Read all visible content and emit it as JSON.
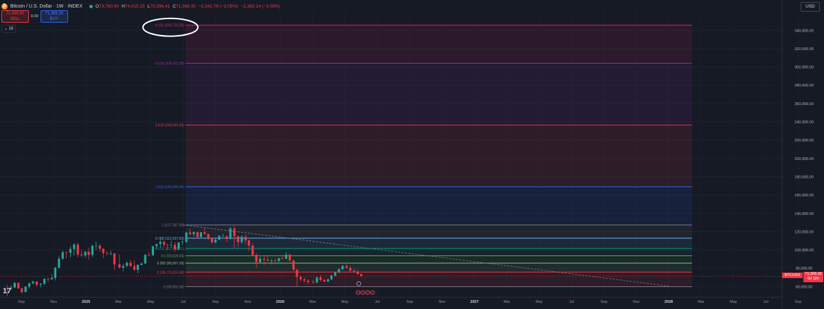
{
  "header": {
    "title": "Bitcoin / U.S. Dollar · 1W · INDEX",
    "ohlc": [
      {
        "k": "O",
        "v": "73,760.90"
      },
      {
        "k": "H",
        "v": "74,015.25"
      },
      {
        "k": "L",
        "v": "70,596.41"
      },
      {
        "k": "C",
        "v": "71,368.30"
      },
      {
        "k": "",
        "v": "−2,242.76 (−3.05%)"
      },
      {
        "k": "",
        "v": "−2,382.14 (−3.09%)"
      }
    ]
  },
  "trade": {
    "sell_price": "71,368.80",
    "sell_label": "SELL",
    "spread": "0.00",
    "buy_price": "71,368.30",
    "buy_label": "BUY"
  },
  "indicator_toggle": "⌄ 18",
  "currency": "USD",
  "last_price": {
    "symbol": "BTCUSD",
    "price": "71,368.30",
    "countdown": "6d 10h"
  },
  "colors": {
    "background": "#161a25",
    "up": "#26a69a",
    "down": "#f23645",
    "highlight_circle": "#ffffff"
  },
  "chart_data": {
    "type": "candlestick",
    "title": "",
    "ylim": [
      52000,
      362000
    ],
    "y_ticks": [
      60000,
      80000,
      100000,
      120000,
      140000,
      160000,
      180000,
      200000,
      220000,
      240000,
      260000,
      280000,
      300000,
      320000,
      340000
    ],
    "y_tick_labels": [
      "60,000.00",
      "80,000.00",
      "100,000.00",
      "120,000.00",
      "140,000.00",
      "160,000.00",
      "180,000.00",
      "200,000.00",
      "220,000.00",
      "240,000.00",
      "260,000.00",
      "280,000.00",
      "300,000.00",
      "320,000.00",
      "340,000.00"
    ],
    "x_labels": [
      "Sep",
      "Nov",
      "2025",
      "Mar",
      "May",
      "Jul",
      "Sep",
      "Nov",
      "2026",
      "Mar",
      "May",
      "Jul",
      "Sep",
      "Nov",
      "2027",
      "Mar",
      "May",
      "Jul",
      "Sep",
      "Nov",
      "2028",
      "Mar",
      "May",
      "Jul",
      "Sep"
    ],
    "x_bold": [
      "2025",
      "2026",
      "2027",
      "2028"
    ],
    "x_months_start": "2024-09",
    "fib_levels": [
      {
        "ratio": 0,
        "label": "0 (59,891.36)",
        "price": 59891.36,
        "color": "#787b86"
      },
      {
        "ratio": 0.236,
        "label": "0.236 (75,815.68)",
        "price": 75815.68,
        "color": "#f23645"
      },
      {
        "ratio": 0.382,
        "label": "0.382 (85,667.29)",
        "price": 85667.29,
        "color": "#81c784"
      },
      {
        "ratio": 0.5,
        "label": "0.5 (93,629.65)",
        "price": 93629.65,
        "color": "#4caf50"
      },
      {
        "ratio": 0.618,
        "label": "0.618 (101,592.01)",
        "price": 101592.01,
        "color": "#089981"
      },
      {
        "ratio": 0.786,
        "label": "0.786 (112,927.93)",
        "price": 112927.93,
        "color": "#64b5f6"
      },
      {
        "ratio": 1,
        "label": "1 (127,367.95)",
        "price": 127367.95,
        "color": "#787b86"
      },
      {
        "ratio": 1.618,
        "label": "1.618 (169,068.60)",
        "price": 169068.6,
        "color": "#2962ff"
      },
      {
        "ratio": 2.618,
        "label": "2.618 (236,545.29)",
        "price": 236545.29,
        "color": "#f23645"
      },
      {
        "ratio": 3.618,
        "label": "3.618 (304,022.18)",
        "price": 304022.18,
        "color": "#9c27b0"
      },
      {
        "ratio": 4.236,
        "label": "4.236 (345,720.56)",
        "price": 345720.56,
        "color": "#e91e63"
      }
    ],
    "trendline": {
      "from": {
        "x": "2025-07",
        "y": 127400
      },
      "to": {
        "x": "2028-01",
        "y": 60500
      }
    },
    "candles": [
      {
        "t": "2024-08-05",
        "o": 58000,
        "h": 62000,
        "l": 49500,
        "c": 57500
      },
      {
        "t": "2024-08-12",
        "o": 57500,
        "h": 61500,
        "l": 56000,
        "c": 59000
      },
      {
        "t": "2024-08-19",
        "o": 59000,
        "h": 65000,
        "l": 58500,
        "c": 64000
      },
      {
        "t": "2024-08-26",
        "o": 64000,
        "h": 64500,
        "l": 57500,
        "c": 58000
      },
      {
        "t": "2024-09-02",
        "o": 58000,
        "h": 58500,
        "l": 52500,
        "c": 54000
      },
      {
        "t": "2024-09-09",
        "o": 54000,
        "h": 60500,
        "l": 53500,
        "c": 60000
      },
      {
        "t": "2024-09-16",
        "o": 60000,
        "h": 64500,
        "l": 58000,
        "c": 63500
      },
      {
        "t": "2024-09-23",
        "o": 63500,
        "h": 66500,
        "l": 62500,
        "c": 65500
      },
      {
        "t": "2024-09-30",
        "o": 65500,
        "h": 66000,
        "l": 59800,
        "c": 62000
      },
      {
        "t": "2024-10-07",
        "o": 62000,
        "h": 64000,
        "l": 58900,
        "c": 63000
      },
      {
        "t": "2024-10-14",
        "o": 63000,
        "h": 69000,
        "l": 62000,
        "c": 68500
      },
      {
        "t": "2024-10-21",
        "o": 68500,
        "h": 69500,
        "l": 65000,
        "c": 68000
      },
      {
        "t": "2024-10-28",
        "o": 68000,
        "h": 73600,
        "l": 67500,
        "c": 69500
      },
      {
        "t": "2024-11-04",
        "o": 69500,
        "h": 81500,
        "l": 66800,
        "c": 80500
      },
      {
        "t": "2024-11-11",
        "o": 80500,
        "h": 93500,
        "l": 80000,
        "c": 90500
      },
      {
        "t": "2024-11-18",
        "o": 90500,
        "h": 99500,
        "l": 89000,
        "c": 97500
      },
      {
        "t": "2024-11-25",
        "o": 97500,
        "h": 98500,
        "l": 90800,
        "c": 97000
      },
      {
        "t": "2024-12-02",
        "o": 97000,
        "h": 104000,
        "l": 92000,
        "c": 101000
      },
      {
        "t": "2024-12-09",
        "o": 101000,
        "h": 107800,
        "l": 94000,
        "c": 106000
      },
      {
        "t": "2024-12-16",
        "o": 106000,
        "h": 108300,
        "l": 92200,
        "c": 95000
      },
      {
        "t": "2024-12-23",
        "o": 95000,
        "h": 100000,
        "l": 92500,
        "c": 94000
      },
      {
        "t": "2024-12-30",
        "o": 94000,
        "h": 99000,
        "l": 91500,
        "c": 98000
      },
      {
        "t": "2025-01-06",
        "o": 98000,
        "h": 102700,
        "l": 89300,
        "c": 94500
      },
      {
        "t": "2025-01-13",
        "o": 94500,
        "h": 106000,
        "l": 92000,
        "c": 104500
      },
      {
        "t": "2025-01-20",
        "o": 104500,
        "h": 109300,
        "l": 99500,
        "c": 104800
      },
      {
        "t": "2025-01-27",
        "o": 104800,
        "h": 106400,
        "l": 97800,
        "c": 101300
      },
      {
        "t": "2025-02-03",
        "o": 101300,
        "h": 102000,
        "l": 91200,
        "c": 96500
      },
      {
        "t": "2025-02-10",
        "o": 96500,
        "h": 98800,
        "l": 94100,
        "c": 96100
      },
      {
        "t": "2025-02-17",
        "o": 96100,
        "h": 99500,
        "l": 94500,
        "c": 96300
      },
      {
        "t": "2025-02-24",
        "o": 96300,
        "h": 96500,
        "l": 78200,
        "c": 84300
      },
      {
        "t": "2025-03-03",
        "o": 84300,
        "h": 95000,
        "l": 80000,
        "c": 80700
      },
      {
        "t": "2025-03-10",
        "o": 80700,
        "h": 85300,
        "l": 76600,
        "c": 82600
      },
      {
        "t": "2025-03-17",
        "o": 82600,
        "h": 87500,
        "l": 81500,
        "c": 86100
      },
      {
        "t": "2025-03-24",
        "o": 86100,
        "h": 88800,
        "l": 81600,
        "c": 82400
      },
      {
        "t": "2025-03-31",
        "o": 82400,
        "h": 88500,
        "l": 77100,
        "c": 78400
      },
      {
        "t": "2025-04-07",
        "o": 78400,
        "h": 84000,
        "l": 74500,
        "c": 83800
      },
      {
        "t": "2025-04-14",
        "o": 83800,
        "h": 86500,
        "l": 83000,
        "c": 85200
      },
      {
        "t": "2025-04-21",
        "o": 85200,
        "h": 95800,
        "l": 85000,
        "c": 94600
      },
      {
        "t": "2025-04-28",
        "o": 94600,
        "h": 97800,
        "l": 92900,
        "c": 94300
      },
      {
        "t": "2025-05-05",
        "o": 94300,
        "h": 104300,
        "l": 93400,
        "c": 104100
      },
      {
        "t": "2025-05-12",
        "o": 104100,
        "h": 105800,
        "l": 100700,
        "c": 106500
      },
      {
        "t": "2025-05-19",
        "o": 106500,
        "h": 111900,
        "l": 102100,
        "c": 109000
      },
      {
        "t": "2025-05-26",
        "o": 109000,
        "h": 110400,
        "l": 103100,
        "c": 105700
      },
      {
        "t": "2025-06-02",
        "o": 105700,
        "h": 106800,
        "l": 100400,
        "c": 105500
      },
      {
        "t": "2025-06-09",
        "o": 105500,
        "h": 110500,
        "l": 102600,
        "c": 105600
      },
      {
        "t": "2025-06-16",
        "o": 105600,
        "h": 108900,
        "l": 98200,
        "c": 100900
      },
      {
        "t": "2025-06-23",
        "o": 100900,
        "h": 108500,
        "l": 99600,
        "c": 108300
      },
      {
        "t": "2025-06-30",
        "o": 108300,
        "h": 110500,
        "l": 105200,
        "c": 108900
      },
      {
        "t": "2025-07-07",
        "o": 108900,
        "h": 119500,
        "l": 107500,
        "c": 119100
      },
      {
        "t": "2025-07-14",
        "o": 119100,
        "h": 123200,
        "l": 115700,
        "c": 117300
      },
      {
        "t": "2025-07-21",
        "o": 117300,
        "h": 120200,
        "l": 114700,
        "c": 119400
      },
      {
        "t": "2025-07-28",
        "o": 119400,
        "h": 119800,
        "l": 112000,
        "c": 114200
      },
      {
        "t": "2025-08-04",
        "o": 114200,
        "h": 119300,
        "l": 112600,
        "c": 119300
      },
      {
        "t": "2025-08-11",
        "o": 119300,
        "h": 124500,
        "l": 116800,
        "c": 117500
      },
      {
        "t": "2025-08-18",
        "o": 117500,
        "h": 117600,
        "l": 110600,
        "c": 113500
      },
      {
        "t": "2025-08-25",
        "o": 113500,
        "h": 113600,
        "l": 107300,
        "c": 108300
      },
      {
        "t": "2025-09-01",
        "o": 108300,
        "h": 113400,
        "l": 107300,
        "c": 111200
      },
      {
        "t": "2025-09-08",
        "o": 111200,
        "h": 116600,
        "l": 110600,
        "c": 115300
      },
      {
        "t": "2025-09-15",
        "o": 115300,
        "h": 117900,
        "l": 114700,
        "c": 115300
      },
      {
        "t": "2025-09-22",
        "o": 115300,
        "h": 115400,
        "l": 108700,
        "c": 112200
      },
      {
        "t": "2025-09-29",
        "o": 112200,
        "h": 125600,
        "l": 111500,
        "c": 123500
      },
      {
        "t": "2025-10-06",
        "o": 123500,
        "h": 126200,
        "l": 102000,
        "c": 114900
      },
      {
        "t": "2025-10-13",
        "o": 114900,
        "h": 115900,
        "l": 103500,
        "c": 108600
      },
      {
        "t": "2025-10-20",
        "o": 108600,
        "h": 116000,
        "l": 106800,
        "c": 114500
      },
      {
        "t": "2025-10-27",
        "o": 114500,
        "h": 116400,
        "l": 106300,
        "c": 110600
      },
      {
        "t": "2025-11-03",
        "o": 110600,
        "h": 110800,
        "l": 98900,
        "c": 104700
      },
      {
        "t": "2025-11-10",
        "o": 104700,
        "h": 107500,
        "l": 94000,
        "c": 94600
      },
      {
        "t": "2025-11-17",
        "o": 94600,
        "h": 96600,
        "l": 80600,
        "c": 86800
      },
      {
        "t": "2025-11-24",
        "o": 86800,
        "h": 93100,
        "l": 85300,
        "c": 90400
      },
      {
        "t": "2025-12-01",
        "o": 90400,
        "h": 94100,
        "l": 83800,
        "c": 89300
      },
      {
        "t": "2025-12-08",
        "o": 89300,
        "h": 94600,
        "l": 87600,
        "c": 88200
      },
      {
        "t": "2025-12-15",
        "o": 88200,
        "h": 90400,
        "l": 84400,
        "c": 88400
      },
      {
        "t": "2025-12-22",
        "o": 88400,
        "h": 90600,
        "l": 86500,
        "c": 87900
      },
      {
        "t": "2025-12-29",
        "o": 87900,
        "h": 91200,
        "l": 86900,
        "c": 91000
      },
      {
        "t": "2026-01-05",
        "o": 91000,
        "h": 94800,
        "l": 89600,
        "c": 90500
      },
      {
        "t": "2026-01-12",
        "o": 90500,
        "h": 97900,
        "l": 89800,
        "c": 95000
      },
      {
        "t": "2026-01-19",
        "o": 95000,
        "h": 95500,
        "l": 87500,
        "c": 88500
      },
      {
        "t": "2026-01-26",
        "o": 88500,
        "h": 89500,
        "l": 76500,
        "c": 78500
      },
      {
        "t": "2026-02-02",
        "o": 78500,
        "h": 79500,
        "l": 60000,
        "c": 70500
      },
      {
        "t": "2026-02-09",
        "o": 70500,
        "h": 72000,
        "l": 65500,
        "c": 68000
      },
      {
        "t": "2026-02-16",
        "o": 68000,
        "h": 69500,
        "l": 64500,
        "c": 66500
      },
      {
        "t": "2026-02-23",
        "o": 66500,
        "h": 68000,
        "l": 62500,
        "c": 65000
      },
      {
        "t": "2026-03-02",
        "o": 65000,
        "h": 67500,
        "l": 63000,
        "c": 64500
      },
      {
        "t": "2026-03-09",
        "o": 64500,
        "h": 71000,
        "l": 63500,
        "c": 70000
      },
      {
        "t": "2026-03-16",
        "o": 70000,
        "h": 72500,
        "l": 66000,
        "c": 67000
      },
      {
        "t": "2026-03-23",
        "o": 67000,
        "h": 69000,
        "l": 64500,
        "c": 65500
      },
      {
        "t": "2026-03-30",
        "o": 65500,
        "h": 68500,
        "l": 64800,
        "c": 68000
      },
      {
        "t": "2026-04-06",
        "o": 68000,
        "h": 73000,
        "l": 67000,
        "c": 72000
      },
      {
        "t": "2026-04-13",
        "o": 72000,
        "h": 76500,
        "l": 71000,
        "c": 75500
      },
      {
        "t": "2026-04-20",
        "o": 75500,
        "h": 80000,
        "l": 74500,
        "c": 79000
      },
      {
        "t": "2026-04-27",
        "o": 79000,
        "h": 83500,
        "l": 78000,
        "c": 82500
      },
      {
        "t": "2026-05-04",
        "o": 82500,
        "h": 84000,
        "l": 79500,
        "c": 80500
      },
      {
        "t": "2026-05-11",
        "o": 80500,
        "h": 82500,
        "l": 76500,
        "c": 77500
      },
      {
        "t": "2026-05-18",
        "o": 77500,
        "h": 79500,
        "l": 75000,
        "c": 76500
      },
      {
        "t": "2026-05-25",
        "o": 76500,
        "h": 78500,
        "l": 73000,
        "c": 73760.9
      },
      {
        "t": "2026-06-01",
        "o": 73760.9,
        "h": 74015.25,
        "l": 70596.41,
        "c": 71368.3
      }
    ]
  }
}
